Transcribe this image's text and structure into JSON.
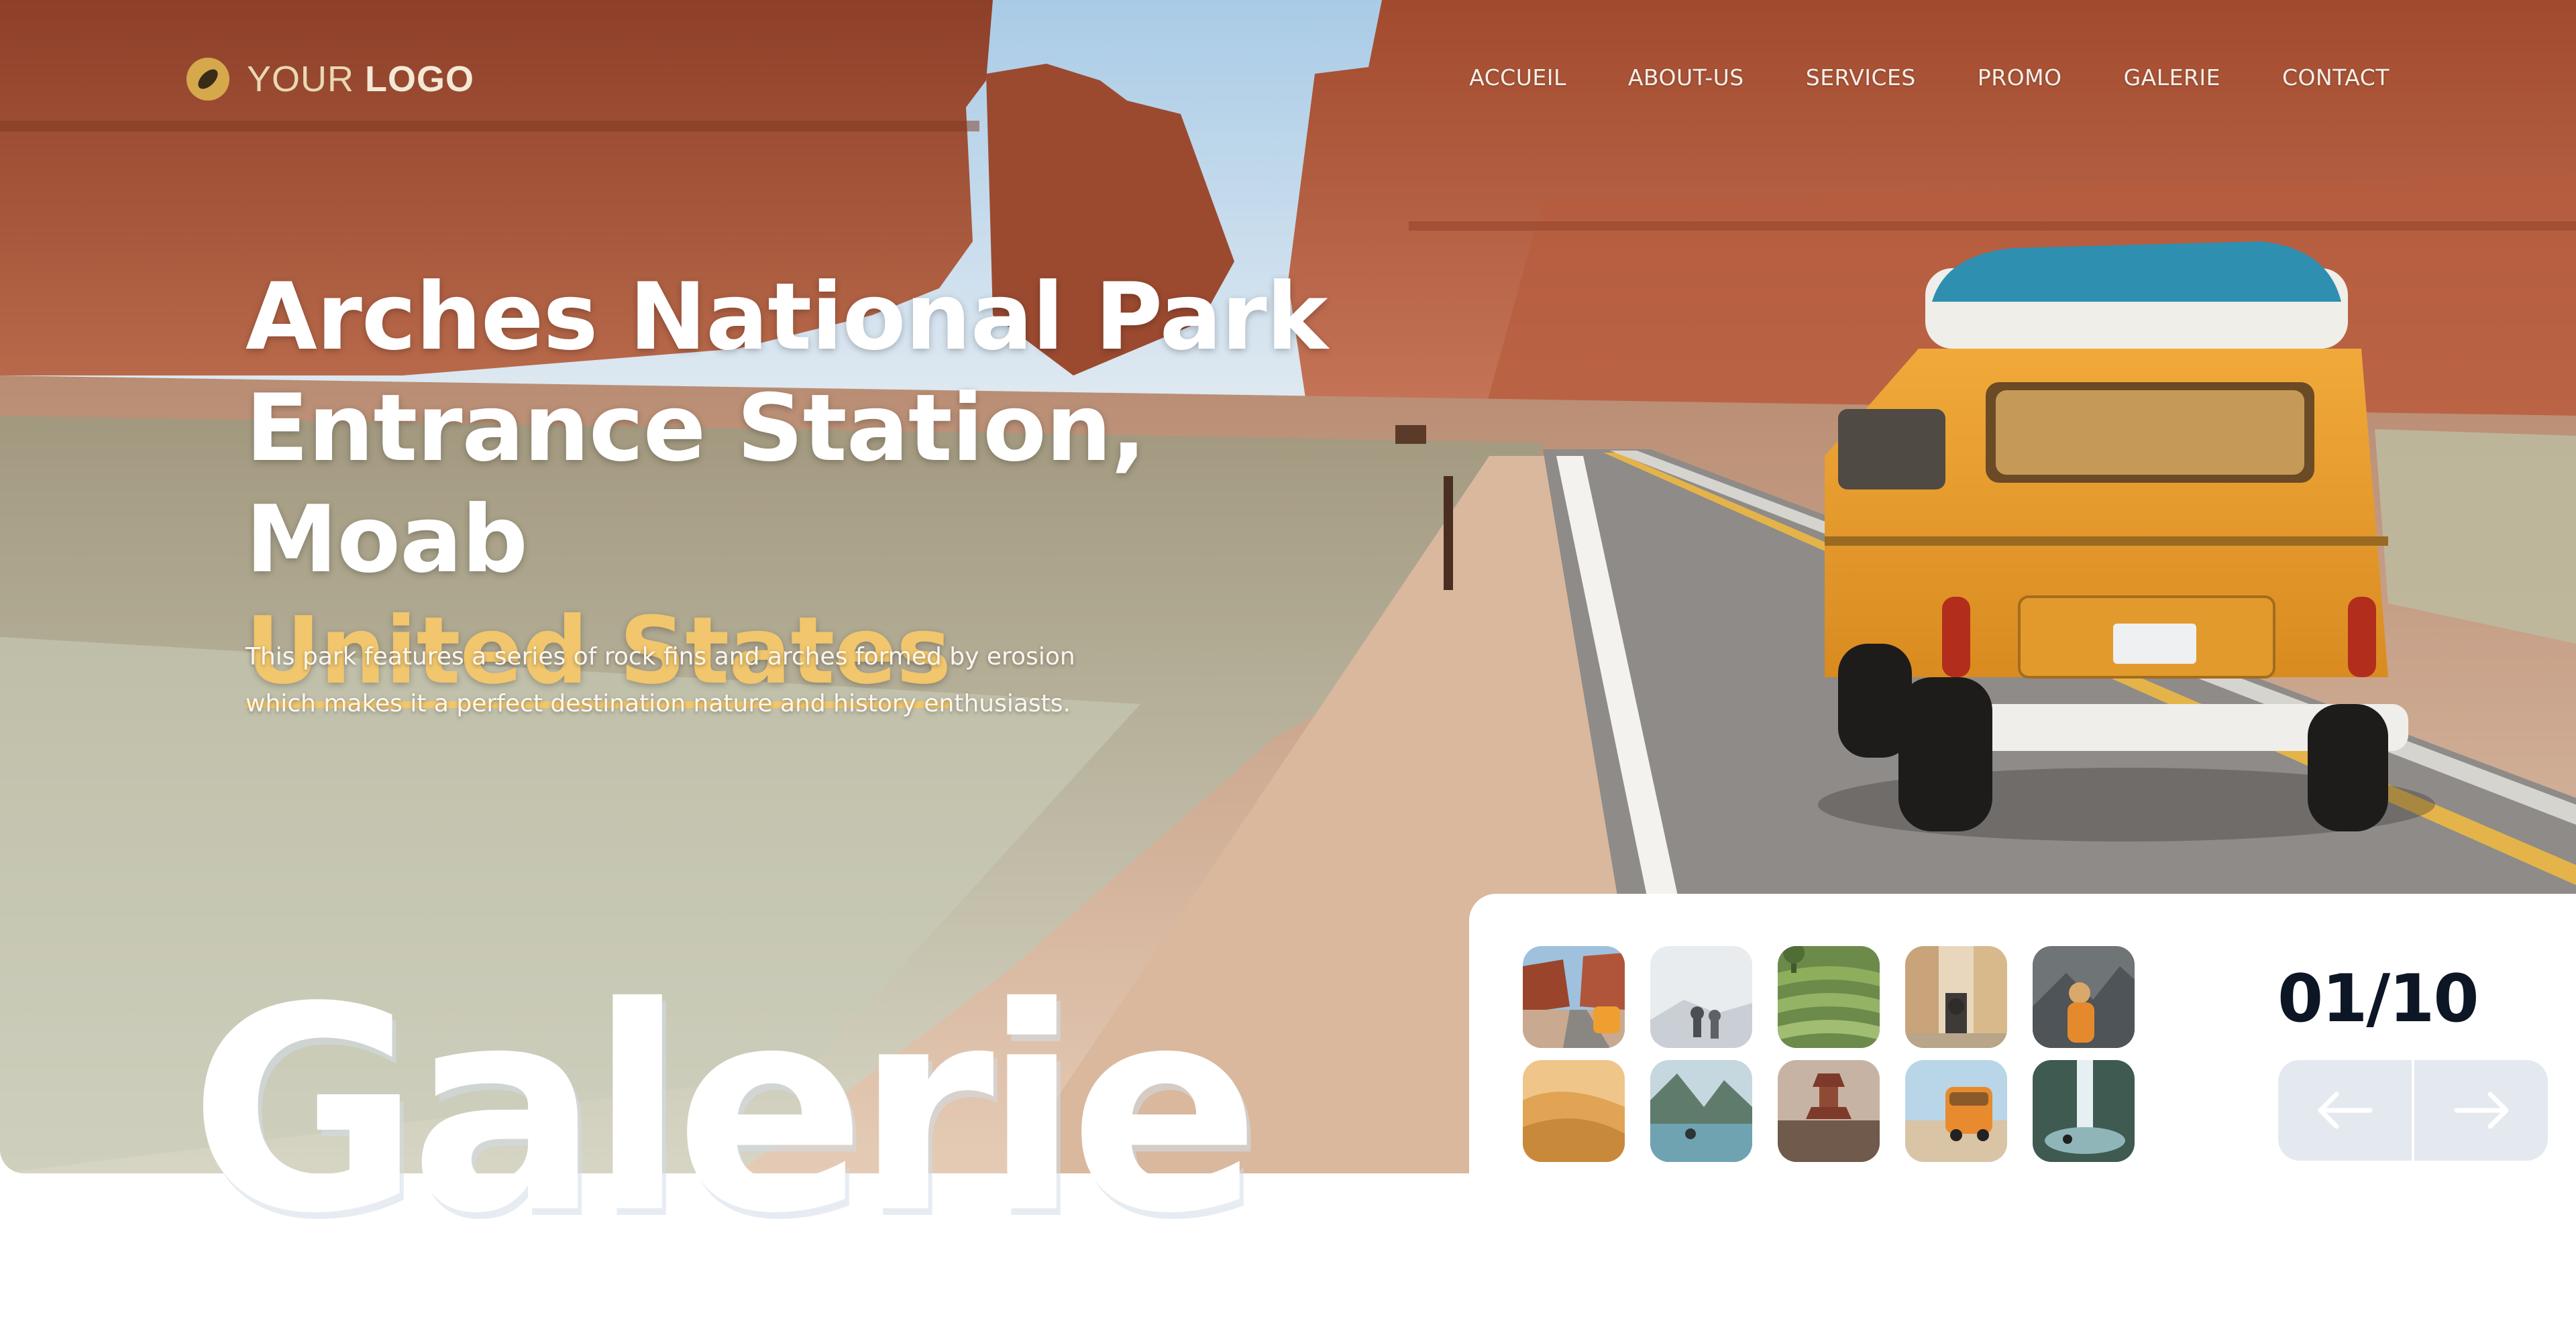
{
  "header": {
    "logo_text_light": "YOUR",
    "logo_text_bold": "LOGO",
    "logo_icon": "compass-icon",
    "nav": [
      "ACCUEIL",
      "ABOUT-US",
      "SERVICES",
      "PROMO",
      "GALERIE",
      "CONTACT"
    ]
  },
  "hero": {
    "title_line1": "Arches National Park",
    "title_line2": "Entrance Station, Moab",
    "title_accent": "United States",
    "description": "This park features a series of rock fins and arches formed by erosion which makes it a perfect destination nature and history enthusiasts.",
    "big_word": "Galerie"
  },
  "gallery": {
    "counter": "01/10",
    "prev_icon": "arrow-left-icon",
    "next_icon": "arrow-right-icon",
    "thumbnails": [
      "canyon-road-thumbnail",
      "misty-mountain-thumbnail",
      "rice-terraces-thumbnail",
      "old-town-street-thumbnail",
      "mountain-hiker-thumbnail",
      "desert-dunes-thumbnail",
      "mountain-lake-thumbnail",
      "pagoda-street-thumbnail",
      "orange-van-beach-thumbnail",
      "waterfall-thumbnail"
    ]
  },
  "colors": {
    "accent": "#f1c66c",
    "dark_text": "#0c1624",
    "arrow_bg": "#e3e9ef"
  }
}
